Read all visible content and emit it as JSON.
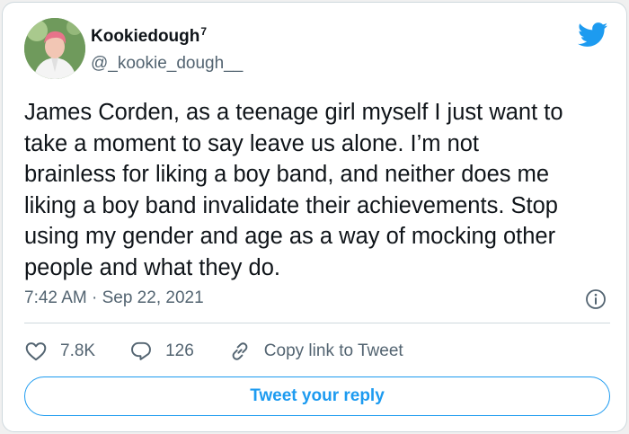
{
  "user": {
    "display_name": "Kookiedough",
    "name_superscript": "7",
    "handle": "@_kookie_dough__"
  },
  "tweet": {
    "text": "James Corden, as a teenage girl myself I just want to\ntake a moment to say leave us alone. I’m not\nbrainless for liking a boy band, and neither does me\nliking a boy band invalidate their achievements. Stop\nusing my gender and age as a way of mocking other\npeople and what they do.",
    "timestamp": "7:42 AM · Sep 22, 2021"
  },
  "actions": {
    "likes": "7.8K",
    "replies": "126",
    "copy_link": "Copy link to Tweet"
  },
  "reply_button": "Tweet your reply",
  "colors": {
    "brand_blue": "#1d9bf0",
    "secondary_text": "#536471",
    "border": "#cfd9de"
  },
  "icons": [
    "twitter-bird-icon",
    "info-icon",
    "heart-icon",
    "reply-bubble-icon",
    "link-icon"
  ]
}
